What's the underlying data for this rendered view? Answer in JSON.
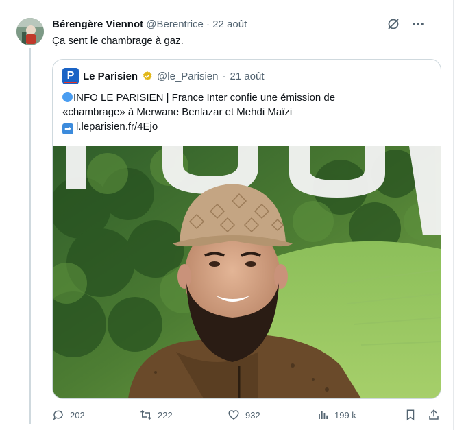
{
  "author": {
    "name": "Bérengère Viennot",
    "handle": "@Berentrice",
    "separator": "·",
    "date": "22 août"
  },
  "tweet": {
    "text": "Ça sent le chambrage à gaz."
  },
  "quote": {
    "logo_letter": "P",
    "name": "Le Parisien",
    "handle": "@le_Parisien",
    "separator": "·",
    "date": "21 août",
    "line1": "INFO LE PARISIEN | France Inter confie une émission de",
    "line2": "«chambrage» à Merwane Benlazar et Mehdi Maïzi",
    "link": "l.leparisien.fr/4Ejo"
  },
  "actions": {
    "replies": "202",
    "retweets": "222",
    "likes": "932",
    "views": "199 k"
  },
  "icons": {
    "top": [
      "grok-slash-icon",
      "more-icon"
    ],
    "actions": [
      "reply-icon",
      "retweet-icon",
      "like-icon",
      "views-icon",
      "bookmark-icon",
      "share-icon"
    ]
  },
  "colors": {
    "text": "#0f1419",
    "secondary": "#536471",
    "border": "#cfd9de",
    "verified": "#e2b719",
    "logo": "#1a63c5"
  }
}
